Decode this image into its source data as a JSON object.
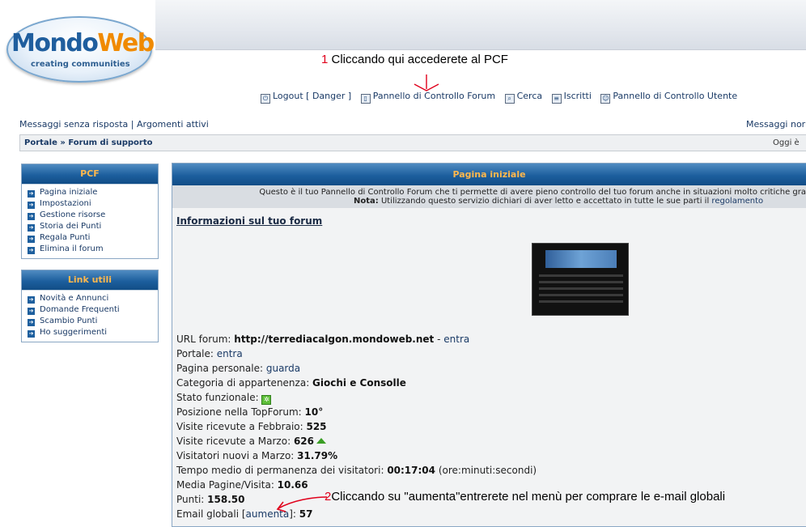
{
  "logo": {
    "part1": "Mondo",
    "part2": "Web",
    "tagline": "creating  communities"
  },
  "annotations": {
    "a1_num": "1",
    "a1_text": " Cliccando qui accederete al PCF",
    "a2_num": "2",
    "a2_text": "Cliccando su \"aumenta\"entrerete nel menù per comprare le e-mail globali",
    "color": "#e0001b"
  },
  "nav": {
    "logout": "Logout [ Danger ]",
    "pcf": "Pannello di Controllo Forum",
    "cerca": "Cerca",
    "iscritti": "Iscritti",
    "pcu": "Pannello di Controllo Utente"
  },
  "quick": {
    "senza_risposta": "Messaggi senza risposta",
    "sep": " | ",
    "attivi": "Argomenti attivi",
    "right": "Messaggi nor"
  },
  "breadcrumb": {
    "portal": "Portale",
    "sep": " » ",
    "forum": "Forum di supporto",
    "right": "Oggi è"
  },
  "sidebar_pcf": {
    "title": "PCF",
    "items": [
      "Pagina iniziale",
      "Impostazioni",
      "Gestione risorse",
      "Storia dei Punti",
      "Regala Punti",
      "Elimina il forum"
    ]
  },
  "sidebar_link": {
    "title": "Link utili",
    "items": [
      "Novità e Annunci",
      "Domande Frequenti",
      "Scambio Punti",
      "Ho suggerimenti"
    ]
  },
  "main": {
    "title": "Pagina iniziale",
    "notice_line1": "Questo è il tuo Pannello di Controllo Forum che ti permette di avere pieno controllo del tuo forum anche in situazioni molto critiche gra",
    "notice_label": "Nota:",
    "notice_line2": " Utilizzando questo servizio dichiari di aver letto e accettato in tutte le sue parti il ",
    "notice_link": "regolamento",
    "info_title": "Informazioni sul tuo forum"
  },
  "stats": {
    "url_label": "URL forum: ",
    "url_value": "http://terrediacalgon.mondoweb.net",
    "url_sep": " - ",
    "url_link": "entra",
    "portale_label": "Portale: ",
    "portale_link": "entra",
    "pagina_label": "Pagina personale: ",
    "pagina_link": "guarda",
    "categoria_label": "Categoria di appartenenza: ",
    "categoria_value": "Giochi e Consolle",
    "stato_label": "Stato funzionale: ",
    "posizione_label": "Posizione nella TopForum: ",
    "posizione_value": "10°",
    "feb_label": "Visite ricevute a Febbraio: ",
    "feb_value": "525",
    "mar_label": "Visite ricevute a Marzo: ",
    "mar_value": "626",
    "nuovi_label": "Visitatori nuovi a Marzo: ",
    "nuovi_value": "31.79%",
    "tempo_label": "Tempo medio di permanenza dei visitatori: ",
    "tempo_value": "00:17:04",
    "tempo_unit": " (ore:minuti:secondi)",
    "media_label": "Media Pagine/Visita: ",
    "media_value": "10.66",
    "punti_label": "Punti: ",
    "punti_value": "158.50",
    "email_label": "Email globali [",
    "email_link": "aumenta",
    "email_close": "]: ",
    "email_value": "57"
  },
  "icons": {
    "logout": "logout-icon",
    "pcf": "door-icon",
    "cerca": "search-icon",
    "iscritti": "list-icon",
    "pcu": "user-icon",
    "status": "status-ok-icon",
    "trend": "up-arrow-icon"
  }
}
